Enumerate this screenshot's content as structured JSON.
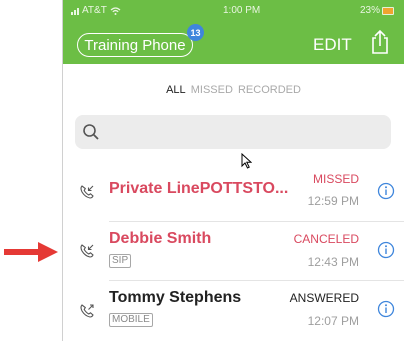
{
  "status_bar": {
    "carrier": "AT&T",
    "time": "1:00 PM",
    "battery": "23%"
  },
  "header": {
    "account_label": "Training Phone",
    "account_badge": "13",
    "edit_label": "EDIT"
  },
  "filters": {
    "all": "ALL",
    "missed": "MISSED",
    "recorded": "RECORDED"
  },
  "search": {
    "placeholder": ""
  },
  "calls": [
    {
      "name": "Private LinePOTTSTO...",
      "tag": "",
      "status": "MISSED",
      "time": "12:59 PM",
      "direction": "incoming"
    },
    {
      "name": "Debbie Smith",
      "tag": "SIP",
      "status": "CANCELED",
      "time": "12:43 PM",
      "direction": "incoming"
    },
    {
      "name": "Tommy Stephens",
      "tag": "MOBILE",
      "status": "ANSWERED",
      "time": "12:07 PM",
      "direction": "outgoing"
    }
  ],
  "colors": {
    "header_green": "#6cbe45",
    "missed_red": "#d9495f",
    "info_blue": "#3f86dc",
    "arrow_red": "#e53935"
  },
  "icons": {
    "share": "share-icon",
    "search": "search-icon",
    "incoming_call": "incoming-call-icon",
    "outgoing_call": "outgoing-call-icon",
    "info": "info-icon",
    "pointer_cursor": "cursor-icon",
    "annotation_arrow": "red-arrow-icon"
  }
}
